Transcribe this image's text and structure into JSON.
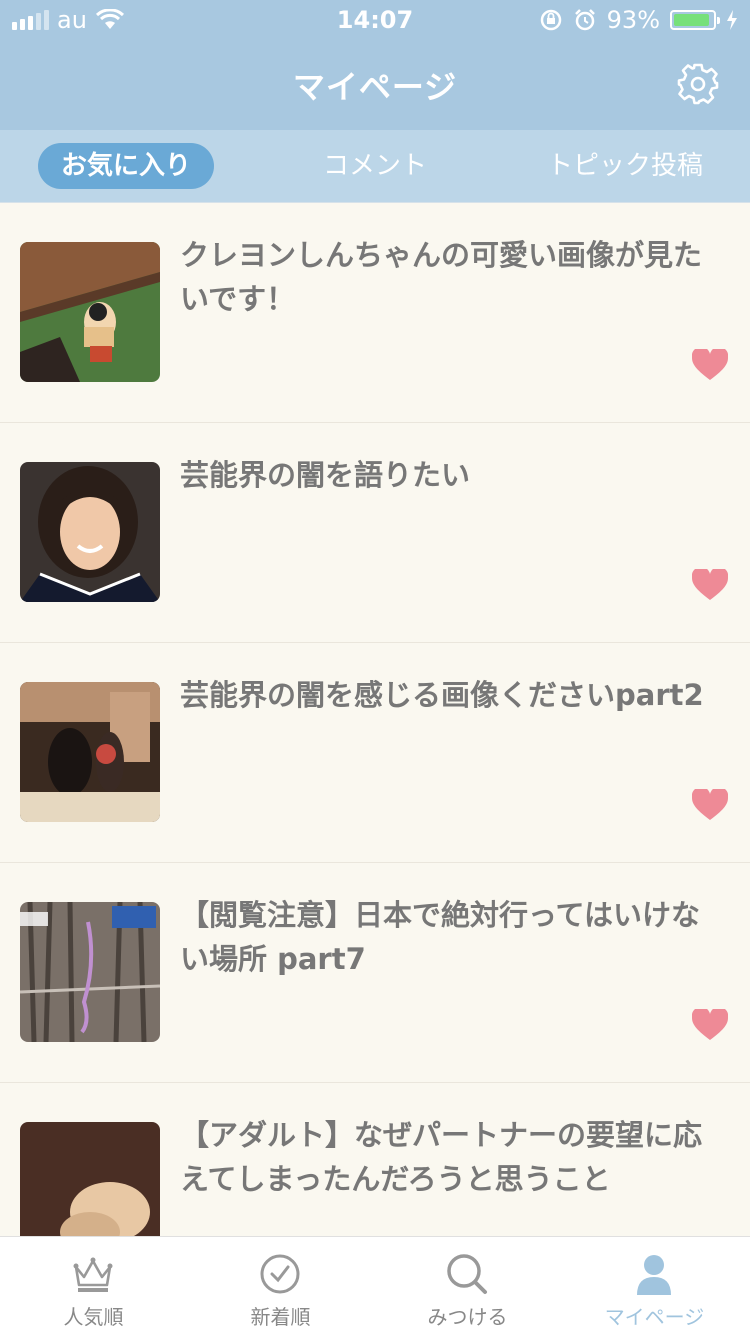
{
  "status_bar": {
    "carrier": "au",
    "time": "14:07",
    "battery_percent": "93%",
    "battery_level": 0.93
  },
  "header": {
    "title": "マイページ",
    "settings_icon": "gear-icon"
  },
  "tabs": [
    {
      "label": "お気に入り",
      "active": true
    },
    {
      "label": "コメント",
      "active": false
    },
    {
      "label": "トピック投稿",
      "active": false
    }
  ],
  "items": [
    {
      "title": "クレヨンしんちゃんの可愛い画像が見たいです！",
      "favorited": true
    },
    {
      "title": "芸能界の闇を語りたい",
      "favorited": true
    },
    {
      "title": "芸能界の闇を感じる画像くださいpart2",
      "favorited": true
    },
    {
      "title": "【閲覧注意】日本で絶対行ってはいけない場所 part7",
      "favorited": true
    },
    {
      "title": "【アダルト】なぜパートナーの要望に応えてしまったんだろうと思うこと",
      "favorited": true
    }
  ],
  "bottom_nav": [
    {
      "label": "人気順",
      "icon": "crown-icon",
      "active": false
    },
    {
      "label": "新着順",
      "icon": "clock-icon",
      "active": false
    },
    {
      "label": "みつける",
      "icon": "search-icon",
      "active": false
    },
    {
      "label": "マイページ",
      "icon": "person-icon",
      "active": true
    }
  ],
  "colors": {
    "header": "#a8c8e0",
    "tab_bar": "#bcd6e8",
    "active_tab": "#6aa9d6",
    "heart": "#ee8a96",
    "background": "#faf8f0"
  }
}
